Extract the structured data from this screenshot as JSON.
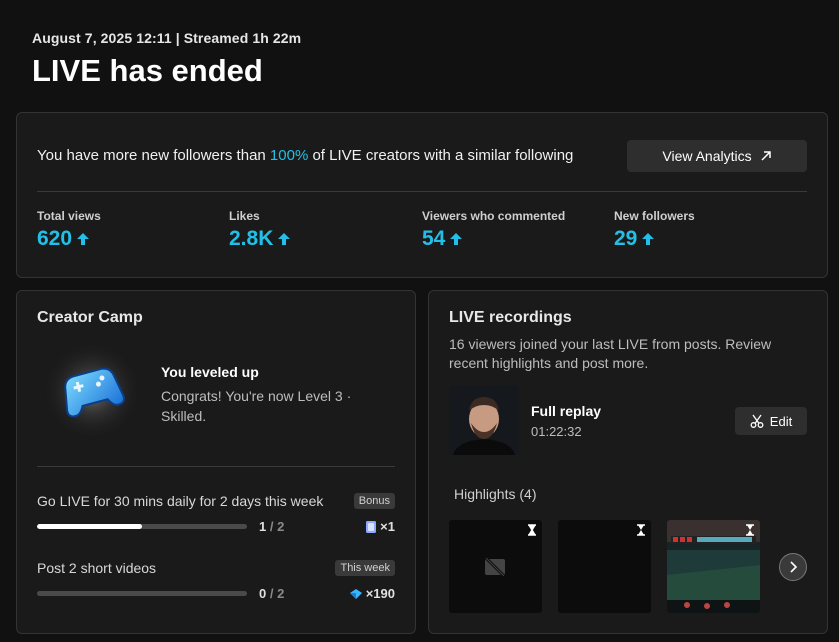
{
  "header": {
    "meta": "August 7, 2025 12:11 | Streamed 1h 22m",
    "title": "LIVE has ended"
  },
  "summary": {
    "text_before": "You have more new followers than ",
    "percent": "100%",
    "text_after": " of LIVE creators with a similar following",
    "analytics_button": "View Analytics",
    "stats": [
      {
        "label": "Total views",
        "value": "620"
      },
      {
        "label": "Likes",
        "value": "2.8K"
      },
      {
        "label": "Viewers who commented",
        "value": "54"
      },
      {
        "label": "New followers",
        "value": "29"
      }
    ]
  },
  "creator_camp": {
    "title": "Creator Camp",
    "level_title": "You leveled up",
    "level_desc": "Congrats! You're now Level 3 · Skilled.",
    "tasks": [
      {
        "name": "Go LIVE for 30 mins daily for 2 days this week",
        "tag": "Bonus",
        "done": "1",
        "total": "2",
        "progress": 0.5,
        "reward": "×1"
      },
      {
        "name": "Post 2 short videos",
        "tag": "This week",
        "done": "0",
        "total": "2",
        "progress": 0.0,
        "reward": "×190"
      }
    ]
  },
  "recordings": {
    "title": "LIVE recordings",
    "desc": "16 viewers joined your last LIVE from posts. Review recent highlights and post more.",
    "replay_title": "Full replay",
    "replay_duration": "01:22:32",
    "edit_button": "Edit",
    "highlights_title": "Highlights (4)"
  },
  "colors": {
    "accent": "#22c0e8",
    "panel": "#1a1a1a",
    "background": "#111111"
  }
}
